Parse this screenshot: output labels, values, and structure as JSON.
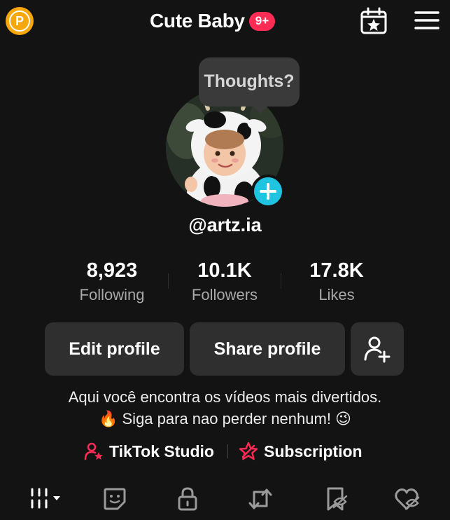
{
  "header": {
    "title": "Cute Baby",
    "notification_badge": "9+",
    "points_icon_letter": "P"
  },
  "bubble": {
    "text": "Thoughts?"
  },
  "profile": {
    "username": "@artz.ia"
  },
  "stats": [
    {
      "value": "8,923",
      "label": "Following"
    },
    {
      "value": "10.1K",
      "label": "Followers"
    },
    {
      "value": "17.8K",
      "label": "Likes"
    }
  ],
  "buttons": {
    "edit": "Edit profile",
    "share": "Share profile"
  },
  "bio": {
    "line1": "Aqui você encontra os vídeos mais divertidos.",
    "line2": "🔥 Siga para nao perder nenhum! 😉"
  },
  "links": {
    "studio": "TikTok Studio",
    "subscription": "Subscription"
  },
  "tabs": [
    "videos-grid-icon",
    "stickers-icon",
    "lock-icon",
    "repost-icon",
    "saved-icon",
    "liked-icon"
  ],
  "colors": {
    "accent": "#fe2c55",
    "cyan": "#20c4e0",
    "coin": "#f6a70c",
    "background": "#131313"
  }
}
